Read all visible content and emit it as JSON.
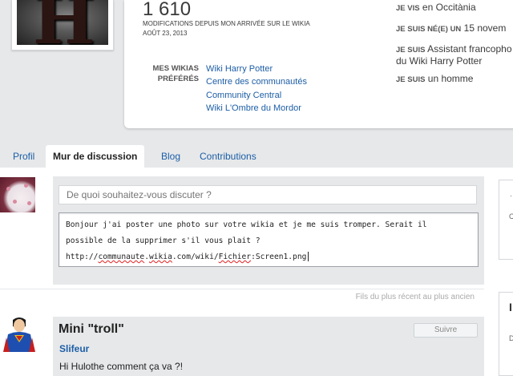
{
  "profile": {
    "avatar_letter": "H",
    "edit_count": "1 610",
    "edit_caption": "MODIFICATIONS DEPUIS MON ARRIVÉE SUR LE WIKIA",
    "join_date": "AOÛT 23, 2013",
    "wikis_label_1": "MES WIKIAS",
    "wikis_label_2": "PRÉFÉRÉS",
    "wikis": [
      "Wiki Harry Potter",
      "Centre des communautés",
      "Community Central",
      "Wiki L'Ombre du Mordor"
    ],
    "info": [
      {
        "key": "JE VIS",
        "value": "en Occitània"
      },
      {
        "key": "JE SUIS NÉ(E) UN",
        "value": "15 novem"
      },
      {
        "key": "JE SUIS",
        "value": "Assistant francopho"
      },
      {
        "key": "",
        "value": "du Wiki Harry Potter"
      },
      {
        "key": "JE SUIS",
        "value": "un homme"
      }
    ]
  },
  "tabs": [
    "Profil",
    "Mur de discussion",
    "Blog",
    "Contributions"
  ],
  "composer": {
    "title_placeholder": "De quoi souhaitez-vous discuter ?",
    "body_line1": "Bonjour j'ai poster une photo sur votre wikia et je me suis tromper. Serait il",
    "body_line2": "possible de la supprimer s'il vous plait ?",
    "body_url_a": "http://",
    "body_url_b": "communaute",
    "body_url_c": ".",
    "body_url_d": "wikia",
    "body_url_e": ".com/wiki/",
    "body_url_f": "Fichier",
    "body_url_g": ":Screen1.png"
  },
  "sort_label": "Fils du plus récent au plus ancien",
  "rail": {
    "top_glyph": "·",
    "top_letter": "C",
    "bottom_letter": "I",
    "bottom_small": "D"
  },
  "thread": {
    "title": "Mini \"troll\"",
    "follow_label": "Suivre",
    "author": "Slifeur",
    "message": "Hi Hulothe comment ça va ?!"
  }
}
